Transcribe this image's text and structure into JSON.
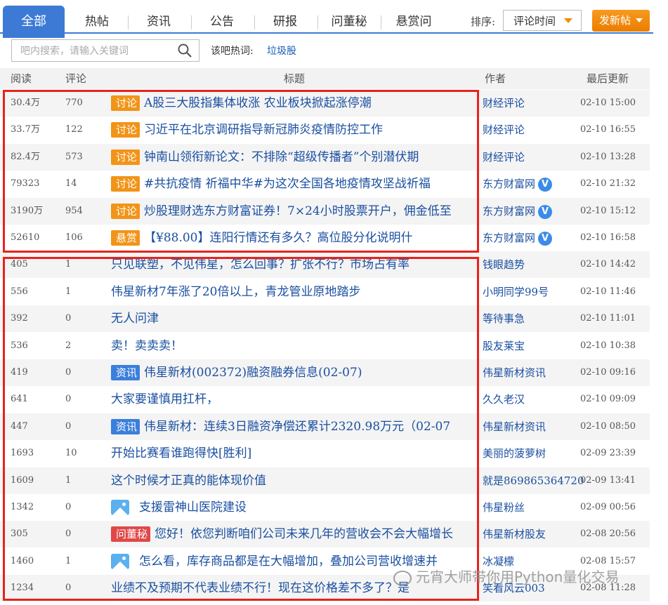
{
  "tabs": {
    "active": "全部",
    "items": [
      "热帖",
      "资讯",
      "公告",
      "研报",
      "问董秘",
      "悬赏问"
    ]
  },
  "sort": {
    "label": "排序:",
    "value": "评论时间"
  },
  "post_button": "发新帖",
  "search": {
    "placeholder": "吧内搜索，请输入关键词"
  },
  "hot": {
    "label": "该吧热词:",
    "word": "垃圾股"
  },
  "columns": {
    "reads": "阅读",
    "comments": "评论",
    "title": "标题",
    "author": "作者",
    "updated": "最后更新"
  },
  "rows": [
    {
      "reads": "30.4万",
      "comments": "770",
      "tag": "讨论",
      "title": "A股三大股指集体收涨 农业板块掀起涨停潮",
      "author": "财经评论",
      "updated": "02-10 15:00"
    },
    {
      "reads": "33.7万",
      "comments": "122",
      "tag": "讨论",
      "title": "习近平在北京调研指导新冠肺炎疫情防控工作",
      "author": "财经评论",
      "updated": "02-10 16:55"
    },
    {
      "reads": "82.4万",
      "comments": "573",
      "tag": "讨论",
      "title": "钟南山领衔新论文：不排除“超级传播者”个别潜伏期",
      "author": "财经评论",
      "updated": "02-10 13:28"
    },
    {
      "reads": "79323",
      "comments": "14",
      "tag": "讨论",
      "title": "#共抗疫情 祈福中华#为这次全国各地疫情攻坚战祈福",
      "author": "东方财富网",
      "verified": "V",
      "updated": "02-10 21:32"
    },
    {
      "reads": "3190万",
      "comments": "954",
      "tag": "讨论",
      "title": "炒股理财选东方财富证券！7×24小时股票开户，佣金低至",
      "author": "东方财富网",
      "verified": "V",
      "updated": "02-10 15:12"
    },
    {
      "reads": "52610",
      "comments": "106",
      "tag": "悬赏",
      "title": "【¥88.00】连阳行情还有多久？高位股分化说明什",
      "author": "东方财富网",
      "verified": "V",
      "updated": "02-10 16:58"
    },
    {
      "reads": "405",
      "comments": "1",
      "title": "只见联塑，不见伟星，怎么回事？扩张不行？市场占有率",
      "author": "钱眼趋势",
      "updated": "02-10 14:42"
    },
    {
      "reads": "556",
      "comments": "1",
      "title": "伟星新材7年涨了20倍以上，青龙管业原地踏步",
      "author": "小明同学99号",
      "updated": "02-10 11:46"
    },
    {
      "reads": "392",
      "comments": "0",
      "title": "无人问津",
      "author": "等待事急",
      "updated": "02-10 11:01"
    },
    {
      "reads": "536",
      "comments": "2",
      "title": "卖！卖卖卖！",
      "author": "股友莱宝",
      "updated": "02-10 10:38"
    },
    {
      "reads": "419",
      "comments": "0",
      "tag": "资讯",
      "title": "伟星新材(002372)融资融券信息(02-07)",
      "author": "伟星新材资讯",
      "updated": "02-10 09:16"
    },
    {
      "reads": "641",
      "comments": "0",
      "title": "大家要谨慎用扛杆，",
      "author": "久久老汉",
      "updated": "02-10 09:09"
    },
    {
      "reads": "447",
      "comments": "0",
      "tag": "资讯",
      "title": "伟星新材：连续3日融资净偿还累计2320.98万元（02-07",
      "author": "伟星新材资讯",
      "updated": "02-10 08:50"
    },
    {
      "reads": "1693",
      "comments": "10",
      "title": "开始比赛看谁跑得快[胜利]",
      "author": "美丽的菠萝树",
      "updated": "02-09 23:39"
    },
    {
      "reads": "1609",
      "comments": "1",
      "title": "这个时候才正真的能体现价值",
      "author": "就是869865364720",
      "updated": "02-09 13:41"
    },
    {
      "reads": "1342",
      "comments": "0",
      "image": true,
      "title": "支援雷神山医院建设",
      "author": "伟星粉丝",
      "updated": "02-09 00:56"
    },
    {
      "reads": "305",
      "comments": "0",
      "tag": "问董秘",
      "title": "您好！依您判断咱们公司未来几年的营收会不会大幅增长",
      "author": "伟星新材股友",
      "updated": "02-08 20:56"
    },
    {
      "reads": "1460",
      "comments": "1",
      "image": true,
      "title": "怎么看，库存商品都是在大幅增加，叠加公司营收增速并",
      "author": "冰凝檬",
      "updated": "02-08 15:57"
    },
    {
      "reads": "1234",
      "comments": "0",
      "title": "业绩不及预期不代表业绩不行！现在这价格差不多了？是",
      "author": "笑看风云003",
      "updated": "02-08 11:28"
    }
  ],
  "watermark": "元宵大师带你用Python量化交易"
}
